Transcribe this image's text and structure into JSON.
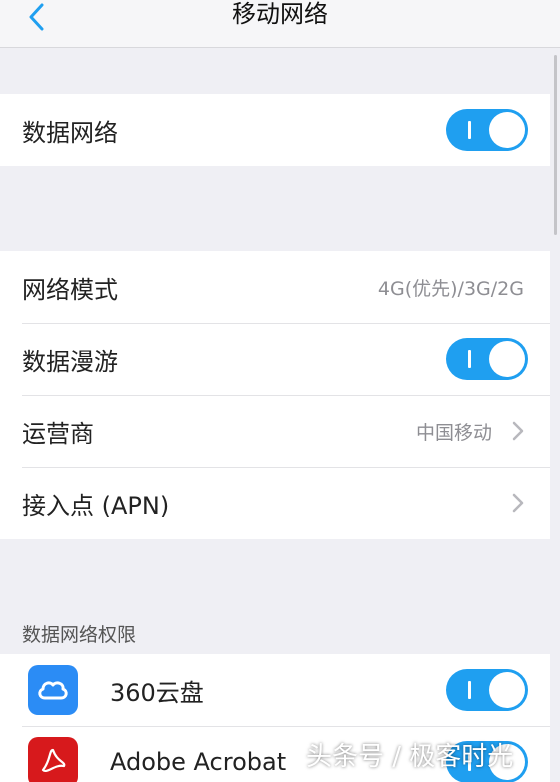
{
  "nav": {
    "title": "移动网络",
    "back_icon": "chevron-left-icon"
  },
  "group1": {
    "data_network": {
      "label": "数据网络",
      "toggle_on": true
    }
  },
  "group2": {
    "network_mode": {
      "label": "网络模式",
      "value": "4G(优先)/3G/2G"
    },
    "data_roaming": {
      "label": "数据漫游",
      "toggle_on": true
    },
    "carrier": {
      "label": "运营商",
      "value": "中国移动"
    },
    "apn": {
      "label": "接入点 (APN)"
    }
  },
  "permissions": {
    "header": "数据网络权限",
    "apps": [
      {
        "name": "360云盘",
        "icon": "cloud-icon",
        "toggle_on": true,
        "color": "#2b8cf5"
      },
      {
        "name": "Adobe Acrobat",
        "icon": "acrobat-icon",
        "toggle_on": true,
        "color": "#d7191c"
      }
    ]
  },
  "watermark": "头条号 / 极客时光",
  "colors": {
    "accent": "#1f9ff0",
    "background": "#efeff4"
  }
}
